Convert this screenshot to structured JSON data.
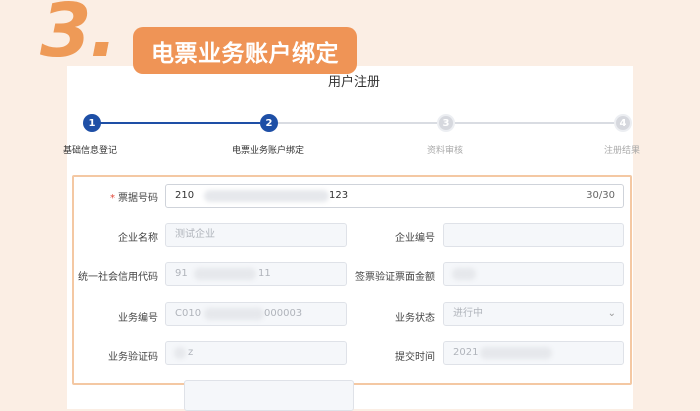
{
  "header": {
    "step_number": "3.",
    "banner_title": "电票业务账户绑定"
  },
  "panel": {
    "title": "用户注册"
  },
  "steps": [
    {
      "num": "1",
      "label": "基础信息登记",
      "state": "done"
    },
    {
      "num": "2",
      "label": "电票业务账户绑定",
      "state": "current"
    },
    {
      "num": "3",
      "label": "资料审核",
      "state": "pending"
    },
    {
      "num": "4",
      "label": "注册结果",
      "state": "pending"
    }
  ],
  "form": {
    "bill_no": {
      "label": "票据号码",
      "required": "*",
      "value_prefix": "210",
      "value_suffix": "123",
      "counter": "30/30"
    },
    "company_name": {
      "label": "企业名称",
      "placeholder": "测试企业"
    },
    "company_code": {
      "label": "企业编号",
      "value": ""
    },
    "credit_code": {
      "label": "统一社会信用代码",
      "value_prefix": "91",
      "value_suffix": "11"
    },
    "face_amount": {
      "label": "签票验证票面金额",
      "value": ""
    },
    "biz_no": {
      "label": "业务编号",
      "value_prefix": "C010",
      "value_suffix": "000003"
    },
    "biz_status": {
      "label": "业务状态",
      "value": "进行中"
    },
    "verify_code": {
      "label": "业务验证码",
      "value_suffix": "z"
    },
    "submit_time": {
      "label": "提交时间",
      "value_prefix": "2021"
    }
  },
  "colors": {
    "accent_orange": "#ef9456",
    "step_active": "#1e4fa6",
    "required": "#e24a3b"
  },
  "icons": {
    "status_dropdown": "chevron-down-icon"
  }
}
